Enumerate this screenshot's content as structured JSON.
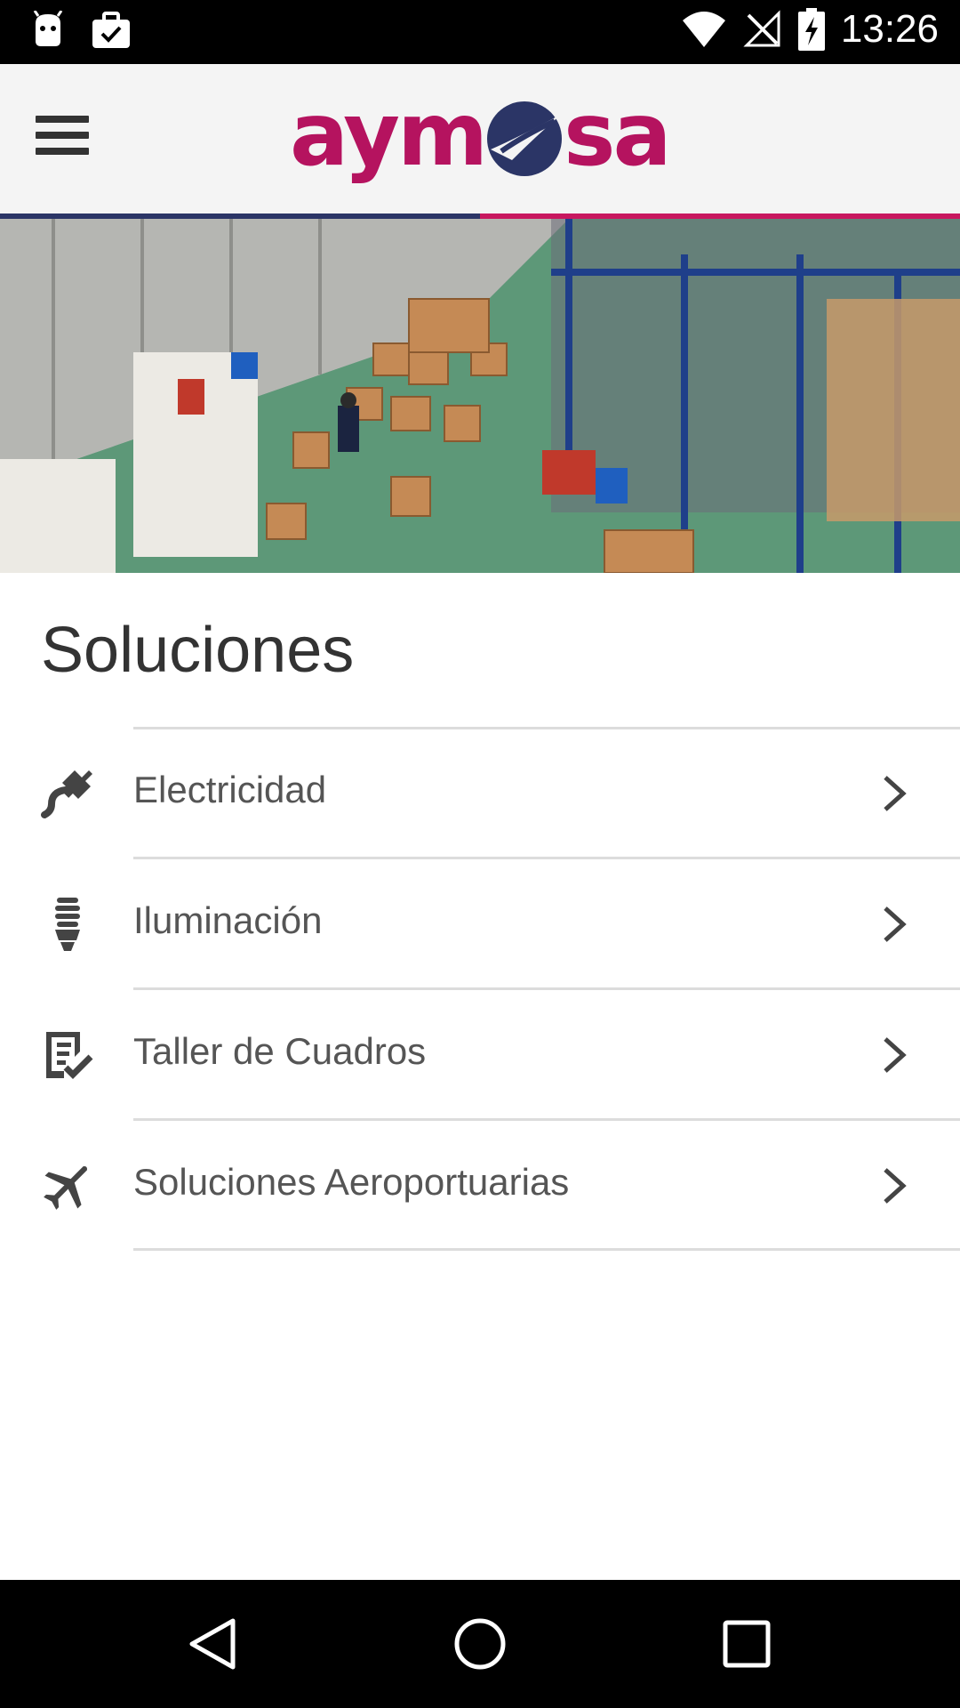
{
  "status_bar": {
    "time": "13:26",
    "icons": [
      "android-debug-icon",
      "briefcase-check-icon",
      "wifi-icon",
      "signal-off-icon",
      "battery-charging-icon"
    ]
  },
  "header": {
    "logo_text_left": "aym",
    "logo_text_right": "sa",
    "brand_pink": "#b5135f",
    "brand_navy": "#2b3566",
    "menu_icon": "hamburger-icon"
  },
  "hero": {
    "icon": "warehouse-photo"
  },
  "main": {
    "title": "Soluciones",
    "items": [
      {
        "label": "Electricidad",
        "icon": "plug-icon"
      },
      {
        "label": "Iluminación",
        "icon": "bulb-icon"
      },
      {
        "label": "Taller de Cuadros",
        "icon": "checklist-icon"
      },
      {
        "label": "Soluciones Aeroportuarias",
        "icon": "airplane-icon"
      }
    ]
  },
  "nav_bar": {
    "icons": [
      "back-icon",
      "home-icon",
      "recents-icon"
    ]
  }
}
